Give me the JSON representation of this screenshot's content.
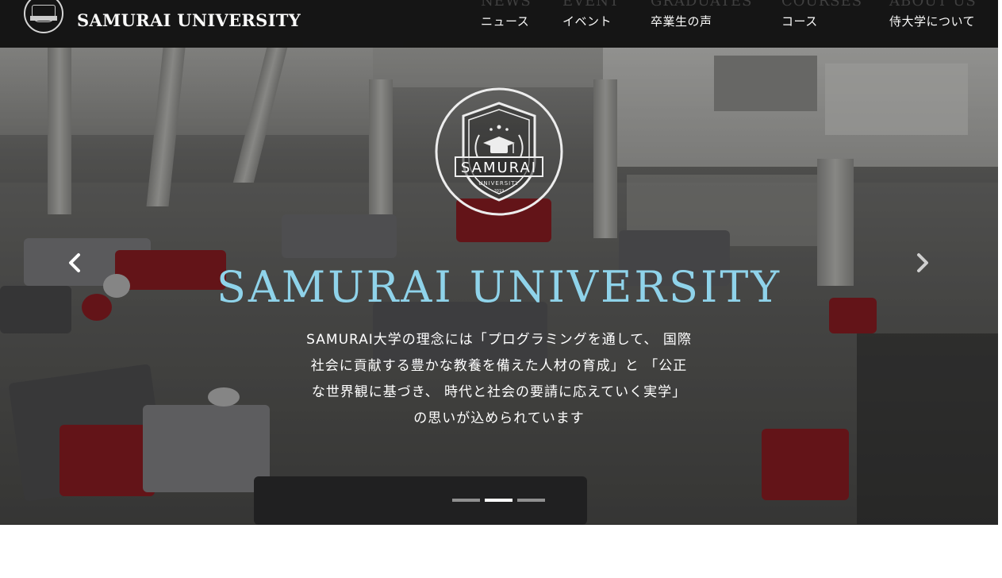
{
  "brand": {
    "name": "SAMURAI UNIVERSITY",
    "logo_icon": "university-emblem-icon"
  },
  "nav": {
    "items": [
      {
        "en": "NEWS",
        "ja": "ニュース"
      },
      {
        "en": "EVENT",
        "ja": "イベント"
      },
      {
        "en": "GRADUATES",
        "ja": "卒業生の声"
      },
      {
        "en": "COURSES",
        "ja": "コース"
      },
      {
        "en": "ABOUT US",
        "ja": "侍大学について"
      }
    ]
  },
  "emblem": {
    "banner_text": "SAMURAI",
    "sub_text": "UNIVERSITY",
    "year_text": "2019",
    "icon": "graduation-cap-shield-icon"
  },
  "hero": {
    "title": "SAMURAI UNIVERSITY",
    "description_lines": [
      "SAMURAI大学の理念には「プログラミングを通して、 国際",
      "社会に貢献する豊かな教養を備えた人材の育成」と 「公正",
      "な世界観に基づき、 時代と社会の要請に応えていく実学」",
      "の思いが込められています"
    ],
    "title_color": "#8fd3ea"
  },
  "carousel": {
    "prev_icon": "chevron-left-icon",
    "next_icon": "chevron-right-icon",
    "slide_count": 3,
    "active_index": 1
  },
  "colors": {
    "navbar_bg": "#111111",
    "nav_en_text": "#3e3e3e",
    "nav_ja_text": "#ffffff",
    "title": "#8fd3ea"
  }
}
